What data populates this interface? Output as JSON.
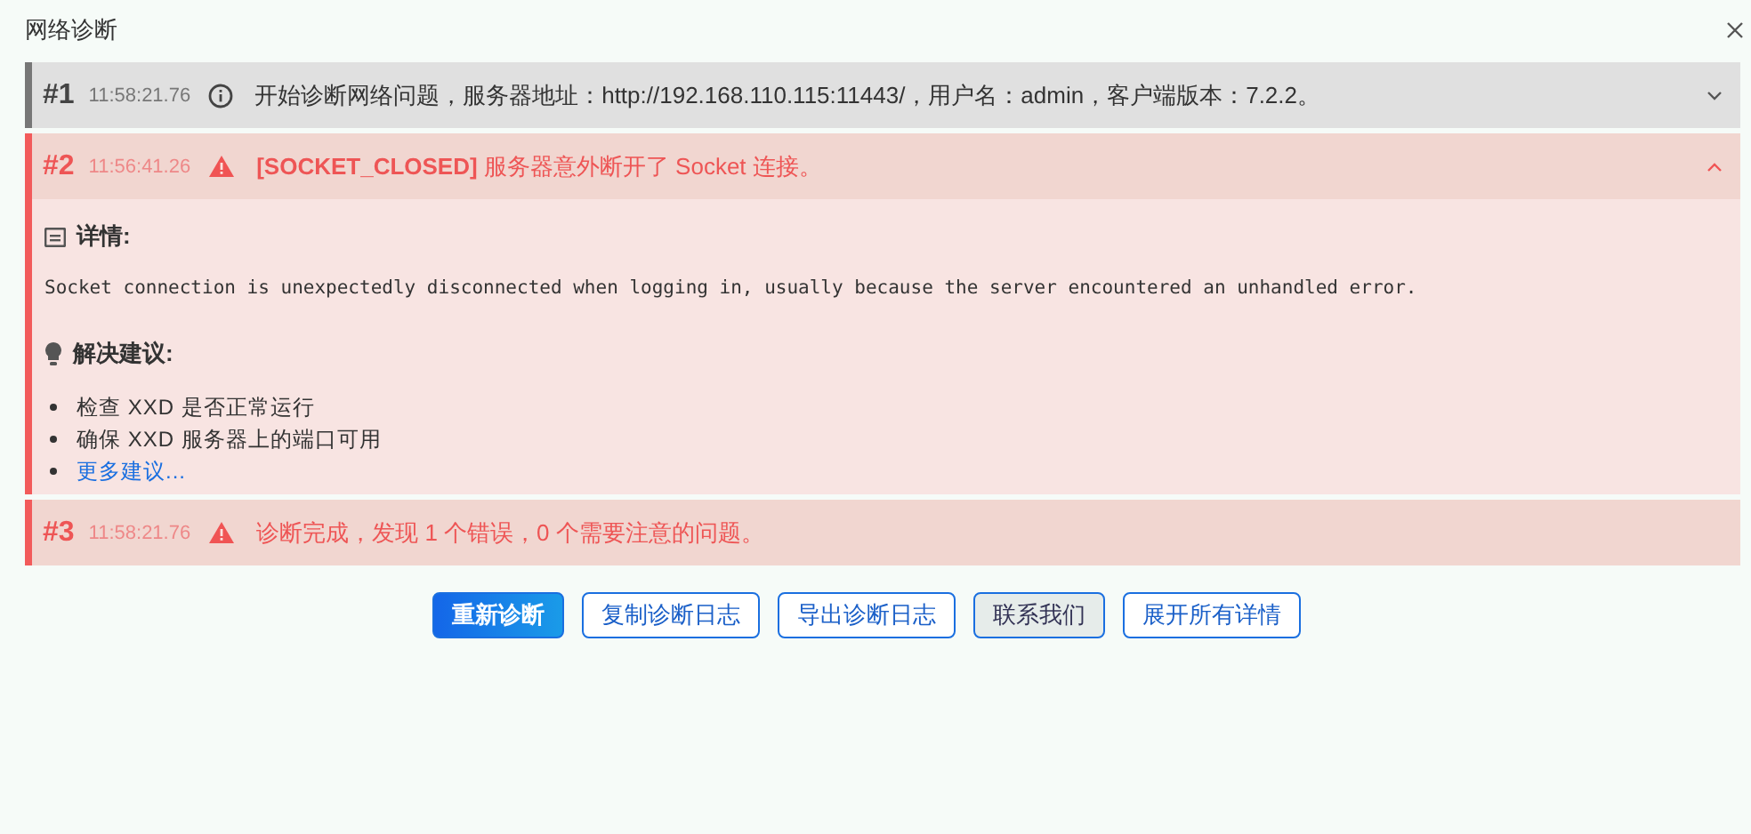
{
  "window": {
    "title": "网络诊断"
  },
  "entries": [
    {
      "number": "#1",
      "time": "11:58:21.76",
      "kind": "info",
      "message": "开始诊断网络问题，服务器地址：http://192.168.110.115:11443/，用户名：admin，客户端版本：7.2.2。",
      "expanded": false
    },
    {
      "number": "#2",
      "time": "11:56:41.26",
      "kind": "error",
      "message": "**[SOCKET_CLOSED]** 服务器意外断开了 Socket 连接。",
      "expanded": true,
      "details": {
        "heading": "详情:",
        "text": "Socket connection is unexpectedly disconnected when logging in, usually because the server encountered an unhandled error.",
        "suggestions_heading": "解决建议:",
        "suggestions": [
          {
            "kind": "text",
            "text": "检查 XXD 是否正常运行"
          },
          {
            "kind": "text",
            "text": "确保 XXD 服务器上的端口可用"
          },
          {
            "kind": "link",
            "text": "更多建议..."
          }
        ]
      }
    },
    {
      "number": "#3",
      "time": "11:58:21.76",
      "kind": "error",
      "message": "诊断完成，发现 1 个错误，0 个需要注意的问题。"
    }
  ],
  "buttons": [
    {
      "label": "重新诊断",
      "kind": "primary"
    },
    {
      "label": "复制诊断日志",
      "kind": "default"
    },
    {
      "label": "导出诊断日志",
      "kind": "default"
    },
    {
      "label": "联系我们",
      "kind": "hover"
    },
    {
      "label": "展开所有详情",
      "kind": "default"
    }
  ]
}
